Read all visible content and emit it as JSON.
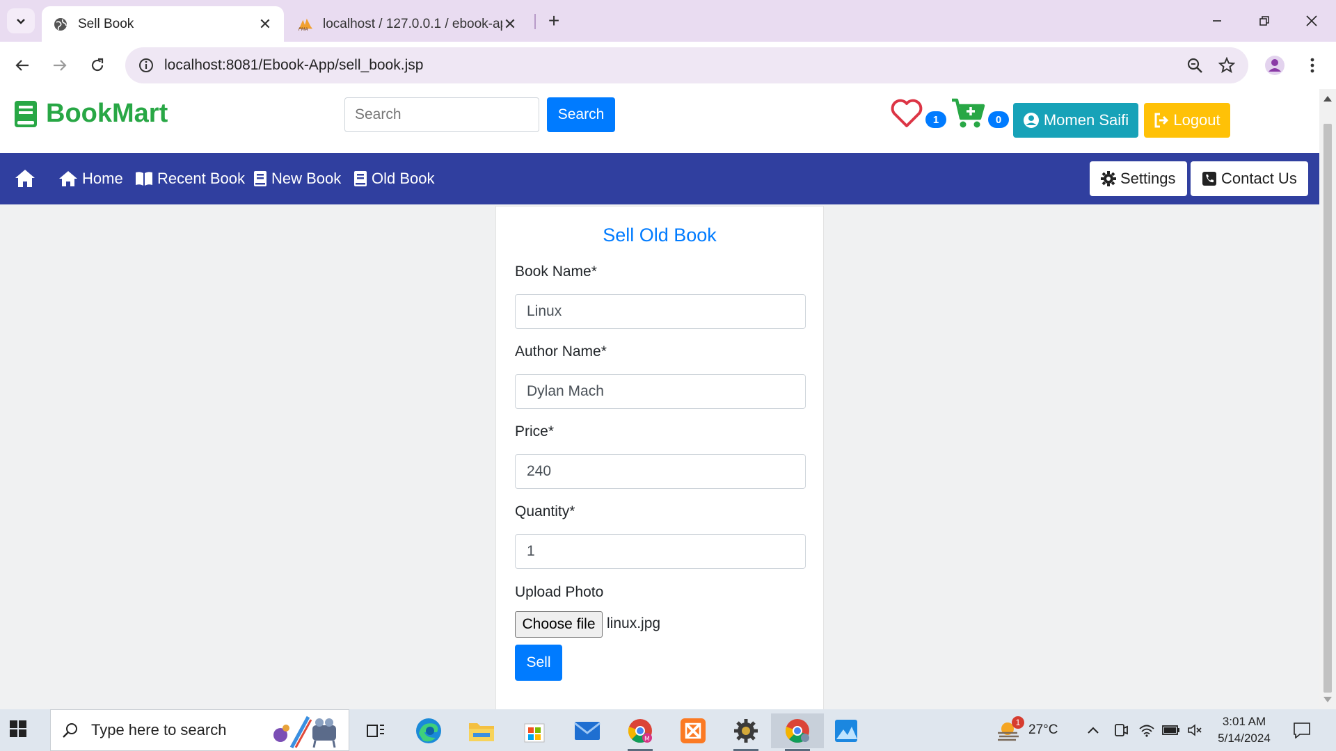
{
  "browser": {
    "tabs": [
      {
        "title": "Sell Book",
        "active": true
      },
      {
        "title": "localhost / 127.0.0.1 / ebook-ap",
        "active": false
      }
    ],
    "url": "localhost:8081/Ebook-App/sell_book.jsp"
  },
  "site": {
    "brand": "BookMart",
    "search_placeholder": "Search",
    "search_button": "Search",
    "wishlist_count": "1",
    "cart_count": "0",
    "user_name": "Momen Saifi",
    "logout_label": "Logout"
  },
  "nav": {
    "items": [
      {
        "label": "Home",
        "icon": "home-icon"
      },
      {
        "label": "Recent Book",
        "icon": "book-open-icon"
      },
      {
        "label": "New Book",
        "icon": "book-icon"
      },
      {
        "label": "Old Book",
        "icon": "book-icon"
      }
    ],
    "settings_label": "Settings",
    "contact_label": "Contact Us"
  },
  "form": {
    "title": "Sell Old Book",
    "book_name_label": "Book Name*",
    "book_name_value": "Linux",
    "author_label": "Author Name*",
    "author_value": "Dylan Mach",
    "price_label": "Price*",
    "price_value": "240",
    "quantity_label": "Quantity*",
    "quantity_value": "1",
    "upload_label": "Upload Photo",
    "choose_file_label": "Choose file",
    "file_name": "linux.jpg",
    "submit_label": "Sell"
  },
  "taskbar": {
    "search_placeholder": "Type here to search",
    "weather_temp": "27°C",
    "weather_badge": "1",
    "time": "3:01 AM",
    "date": "5/14/2024"
  },
  "colors": {
    "brand": "#28a745",
    "primary": "#007bff",
    "navbar": "#303f9f",
    "info": "#17a2b8",
    "warning": "#ffc107"
  }
}
